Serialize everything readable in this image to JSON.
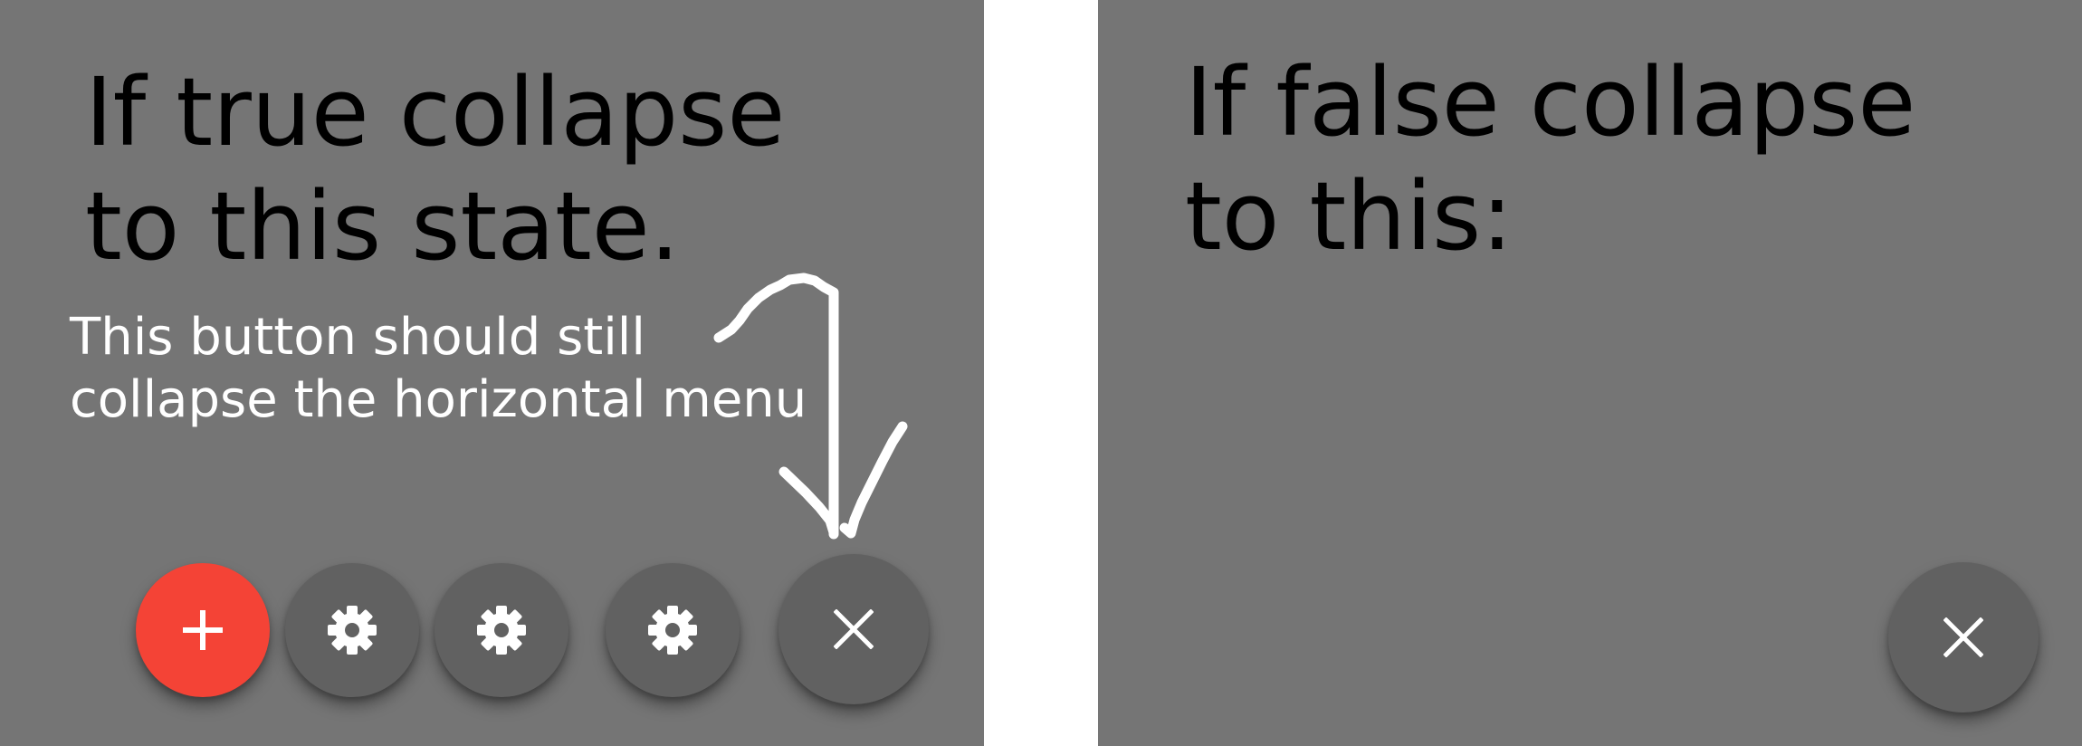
{
  "left_panel": {
    "heading_lines": [
      "If true collapse",
      "to this state."
    ],
    "note_lines": [
      "This button should still",
      "collapse the horizontal menu"
    ],
    "buttons": [
      {
        "icon": "plus-icon",
        "color": "#f44336"
      },
      {
        "icon": "gear-icon",
        "color": "#616161"
      },
      {
        "icon": "gear-icon",
        "color": "#616161"
      },
      {
        "icon": "gear-icon",
        "color": "#616161"
      },
      {
        "icon": "close-icon",
        "color": "#616161"
      }
    ]
  },
  "right_panel": {
    "heading_lines": [
      "If false collapse",
      "to this:"
    ],
    "buttons": [
      {
        "icon": "close-icon",
        "color": "#616161"
      }
    ]
  },
  "colors": {
    "panel_bg": "#757575",
    "page_bg": "#ffffff",
    "fab_accent": "#f44336",
    "fab_dark": "#616161"
  }
}
